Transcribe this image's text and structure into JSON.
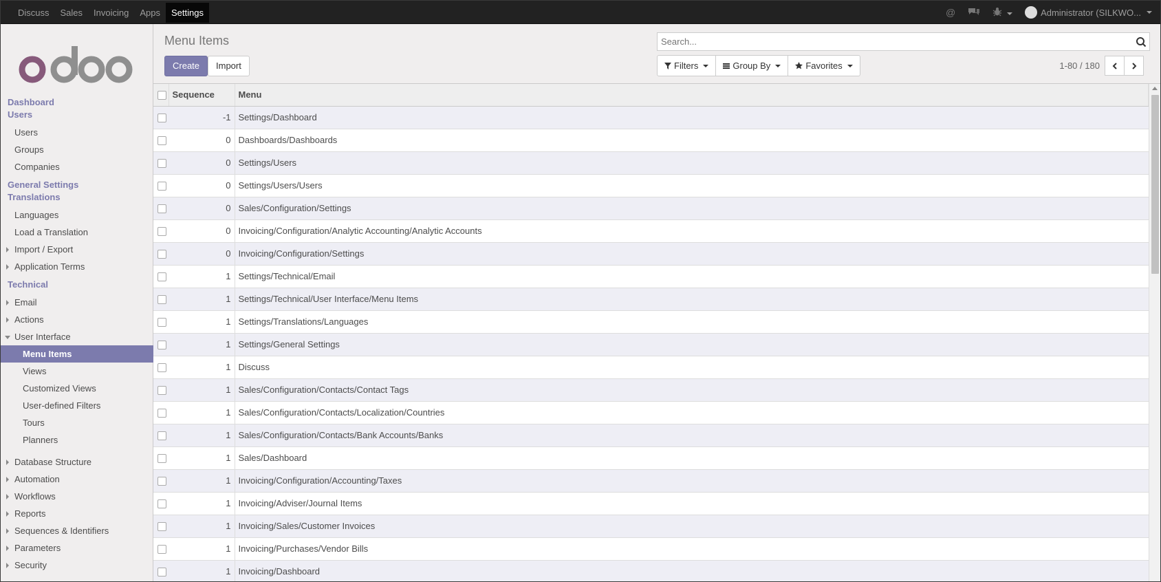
{
  "topbar": {
    "apps": [
      "Discuss",
      "Sales",
      "Invoicing",
      "Apps",
      "Settings"
    ],
    "active_app": "Settings",
    "user_label": "Administrator (SILKWO..."
  },
  "sidebar": {
    "sections": [
      {
        "label": "Dashboard",
        "items": []
      },
      {
        "label": "Users",
        "items": [
          {
            "label": "Users"
          },
          {
            "label": "Groups"
          },
          {
            "label": "Companies"
          }
        ]
      },
      {
        "label": "General Settings",
        "items": []
      },
      {
        "label": "Translations",
        "items": [
          {
            "label": "Languages"
          },
          {
            "label": "Load a Translation"
          },
          {
            "label": "Import / Export"
          },
          {
            "label": "Application Terms"
          }
        ]
      },
      {
        "label": "Technical",
        "items": [
          {
            "label": "Email"
          },
          {
            "label": "Actions"
          },
          {
            "label": "User Interface"
          },
          {
            "label": "Menu Items"
          },
          {
            "label": "Views"
          },
          {
            "label": "Customized Views"
          },
          {
            "label": "User-defined Filters"
          },
          {
            "label": "Tours"
          },
          {
            "label": "Planners"
          },
          {
            "label": "Database Structure"
          },
          {
            "label": "Automation"
          },
          {
            "label": "Workflows"
          },
          {
            "label": "Reports"
          },
          {
            "label": "Sequences & Identifiers"
          },
          {
            "label": "Parameters"
          },
          {
            "label": "Security"
          }
        ]
      }
    ]
  },
  "control_panel": {
    "title": "Menu Items",
    "create_label": "Create",
    "import_label": "Import",
    "search_placeholder": "Search...",
    "filters_label": "Filters",
    "groupby_label": "Group By",
    "favorites_label": "Favorites",
    "pager_value": "1-80",
    "pager_sep": "/",
    "pager_total": "180"
  },
  "list": {
    "headers": [
      "Sequence",
      "Menu"
    ],
    "rows": [
      {
        "seq": "-1",
        "menu": "Settings/Dashboard"
      },
      {
        "seq": "0",
        "menu": "Dashboards/Dashboards"
      },
      {
        "seq": "0",
        "menu": "Settings/Users"
      },
      {
        "seq": "0",
        "menu": "Settings/Users/Users"
      },
      {
        "seq": "0",
        "menu": "Sales/Configuration/Settings"
      },
      {
        "seq": "0",
        "menu": "Invoicing/Configuration/Analytic Accounting/Analytic Accounts"
      },
      {
        "seq": "0",
        "menu": "Invoicing/Configuration/Settings"
      },
      {
        "seq": "1",
        "menu": "Settings/Technical/Email"
      },
      {
        "seq": "1",
        "menu": "Settings/Technical/User Interface/Menu Items"
      },
      {
        "seq": "1",
        "menu": "Settings/Translations/Languages"
      },
      {
        "seq": "1",
        "menu": "Settings/General Settings"
      },
      {
        "seq": "1",
        "menu": "Discuss"
      },
      {
        "seq": "1",
        "menu": "Sales/Configuration/Contacts/Contact Tags"
      },
      {
        "seq": "1",
        "menu": "Sales/Configuration/Contacts/Localization/Countries"
      },
      {
        "seq": "1",
        "menu": "Sales/Configuration/Contacts/Bank Accounts/Banks"
      },
      {
        "seq": "1",
        "menu": "Sales/Dashboard"
      },
      {
        "seq": "1",
        "menu": "Invoicing/Configuration/Accounting/Taxes"
      },
      {
        "seq": "1",
        "menu": "Invoicing/Adviser/Journal Items"
      },
      {
        "seq": "1",
        "menu": "Invoicing/Sales/Customer Invoices"
      },
      {
        "seq": "1",
        "menu": "Invoicing/Purchases/Vendor Bills"
      },
      {
        "seq": "1",
        "menu": "Invoicing/Dashboard"
      }
    ]
  },
  "colors": {
    "brand": "#7c7bad",
    "logo_o": "#875a7b",
    "logo_grey": "#8f8f8f",
    "navbar": "#222222"
  }
}
